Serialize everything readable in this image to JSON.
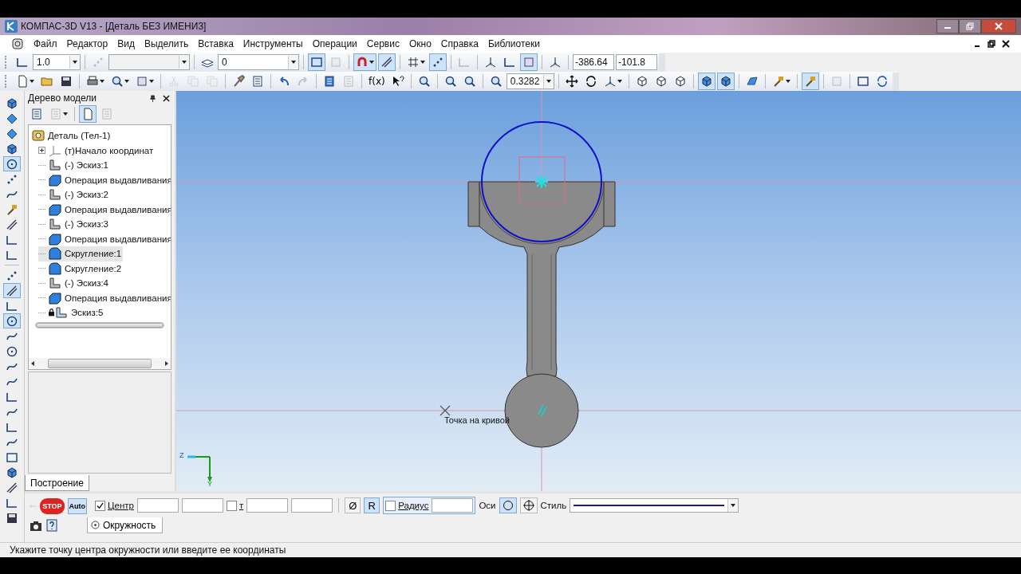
{
  "window": {
    "title": "КОМПАС-3D V13 - [Деталь БЕЗ ИМЕНИ3]"
  },
  "menu": [
    "Файл",
    "Редактор",
    "Вид",
    "Выделить",
    "Вставка",
    "Инструменты",
    "Операции",
    "Сервис",
    "Окно",
    "Справка",
    "Библиотеки"
  ],
  "toolbar_1": [
    {
      "kind": "button",
      "pressed": false,
      "disabled": false
    },
    {
      "kind": "combo",
      "value": "1.0",
      "disabled": false
    },
    {
      "kind": "button",
      "pressed": false,
      "disabled": true
    },
    {
      "kind": "combo",
      "disabled": true
    },
    {
      "kind": "button",
      "pressed": false,
      "disabled": false
    },
    {
      "kind": "combo",
      "value": "0",
      "disabled": false
    },
    {
      "kind": "button",
      "pressed": true,
      "disabled": false
    },
    {
      "kind": "button",
      "pressed": false,
      "disabled": true
    },
    {
      "kind": "button",
      "pressed": true,
      "disabled": false
    },
    {
      "kind": "button",
      "pressed": true,
      "disabled": false
    },
    {
      "kind": "button",
      "pressed": false,
      "disabled": false
    },
    {
      "kind": "button",
      "pressed": true,
      "disabled": false
    },
    {
      "kind": "button",
      "pressed": false,
      "disabled": true
    },
    {
      "kind": "button",
      "pressed": false,
      "disabled": false
    },
    {
      "kind": "button",
      "pressed": false,
      "disabled": false
    },
    {
      "kind": "button",
      "pressed": true,
      "disabled": false
    },
    {
      "kind": "button",
      "pressed": false,
      "disabled": false
    },
    {
      "kind": "field",
      "value": "-386.64"
    },
    {
      "kind": "field",
      "value": "-101.8"
    }
  ],
  "toolbar_2": [
    {
      "kind": "button",
      "pressed": false,
      "disabled": false
    },
    {
      "kind": "button",
      "pressed": false,
      "disabled": false
    },
    {
      "kind": "button",
      "pressed": false,
      "disabled": false
    },
    {
      "kind": "button",
      "pressed": false,
      "disabled": false
    },
    {
      "kind": "button",
      "pressed": false,
      "disabled": false
    },
    {
      "kind": "button",
      "pressed": false,
      "disabled": false
    },
    {
      "kind": "button",
      "pressed": false,
      "disabled": true
    },
    {
      "kind": "button",
      "pressed": false,
      "disabled": true
    },
    {
      "kind": "button",
      "pressed": false,
      "disabled": true
    },
    {
      "kind": "button",
      "pressed": false,
      "disabled": false
    },
    {
      "kind": "button",
      "pressed": false,
      "disabled": false
    },
    {
      "kind": "button",
      "pressed": false,
      "disabled": false
    },
    {
      "kind": "button",
      "pressed": false,
      "disabled": true
    },
    {
      "kind": "button",
      "pressed": false,
      "disabled": false
    },
    {
      "kind": "button",
      "pressed": false,
      "disabled": true
    },
    {
      "kind": "text_button",
      "label": "f(x)"
    },
    {
      "kind": "button",
      "pressed": false,
      "disabled": false
    },
    {
      "kind": "button",
      "pressed": false,
      "disabled": false
    },
    {
      "kind": "button",
      "pressed": false,
      "disabled": false
    },
    {
      "kind": "button",
      "pressed": false,
      "disabled": false
    },
    {
      "kind": "button",
      "pressed": false,
      "disabled": false
    },
    {
      "kind": "combo",
      "value": "0.3282",
      "disabled": false
    },
    {
      "kind": "button",
      "pressed": false,
      "disabled": false
    },
    {
      "kind": "button",
      "pressed": false,
      "disabled": false
    },
    {
      "kind": "button",
      "pressed": false,
      "disabled": false
    },
    {
      "kind": "button",
      "pressed": false,
      "disabled": false
    },
    {
      "kind": "button",
      "pressed": false,
      "disabled": false
    },
    {
      "kind": "button",
      "pressed": false,
      "disabled": false
    },
    {
      "kind": "button",
      "pressed": true,
      "disabled": false
    },
    {
      "kind": "button",
      "pressed": true,
      "disabled": false
    },
    {
      "kind": "button",
      "pressed": false,
      "disabled": false
    },
    {
      "kind": "button",
      "pressed": false,
      "disabled": false
    },
    {
      "kind": "button",
      "pressed": true,
      "disabled": false
    },
    {
      "kind": "button",
      "pressed": false,
      "disabled": true
    },
    {
      "kind": "button",
      "pressed": false,
      "disabled": false
    },
    {
      "kind": "button",
      "pressed": false,
      "disabled": false
    }
  ],
  "left_toolbar": [
    {
      "pressed": false
    },
    {
      "pressed": false
    },
    {
      "pressed": false
    },
    {
      "pressed": false
    },
    {
      "pressed": true
    },
    {
      "pressed": false
    },
    {
      "pressed": false
    },
    {
      "pressed": false
    },
    {
      "pressed": false
    },
    {
      "pressed": false
    },
    {
      "pressed": false
    },
    {
      "pressed": false
    },
    {
      "pressed": true
    },
    {
      "pressed": false
    },
    {
      "pressed": true
    },
    {
      "pressed": false
    },
    {
      "pressed": false
    },
    {
      "pressed": false
    },
    {
      "pressed": false
    },
    {
      "pressed": false
    },
    {
      "pressed": false
    },
    {
      "pressed": false
    },
    {
      "pressed": false
    },
    {
      "pressed": false
    },
    {
      "pressed": false
    },
    {
      "pressed": false
    },
    {
      "pressed": false
    },
    {
      "pressed": false
    }
  ],
  "model_tree": {
    "title": "Дерево модели",
    "root": {
      "label": "Деталь (Тел-1)",
      "kind": "part",
      "selected": false,
      "children": [
        {
          "label": "(т)Начало координат",
          "kind": "origin",
          "selected": false,
          "expanded": false
        },
        {
          "label": "(-) Эскиз:1",
          "kind": "sketch",
          "selected": false
        },
        {
          "label": "Операция выдавливания",
          "kind": "extrude",
          "selected": false
        },
        {
          "label": "(-) Эскиз:2",
          "kind": "sketch",
          "selected": false
        },
        {
          "label": "Операция выдавливания",
          "kind": "extrude",
          "selected": false
        },
        {
          "label": "(-) Эскиз:3",
          "kind": "sketch",
          "selected": false
        },
        {
          "label": "Операция выдавливания",
          "kind": "extrude",
          "selected": false
        },
        {
          "label": "Скругление:1",
          "kind": "fillet",
          "selected": true
        },
        {
          "label": "Скругление:2",
          "kind": "fillet",
          "selected": false
        },
        {
          "label": "(-) Эскиз:4",
          "kind": "sketch",
          "selected": false
        },
        {
          "label": "Операция выдавливания",
          "kind": "extrude",
          "selected": false
        },
        {
          "label": "Эскиз:5",
          "kind": "sketch_locked",
          "selected": false
        }
      ]
    }
  },
  "panel_tabs": [
    {
      "label": "Построение",
      "selected": true
    }
  ],
  "canvas": {
    "hint": "Точка на кривой",
    "axis_labels": [
      "Z",
      "Y"
    ]
  },
  "property_bar": {
    "stop_label": "STOP",
    "auto_label": "Auto",
    "center": {
      "label": "Центр",
      "checked": true
    },
    "t": {
      "label": "т",
      "checked": false
    },
    "diameter": {
      "label": "Ø",
      "pressed": false
    },
    "radius_button": {
      "label": "R",
      "pressed": true
    },
    "radius": {
      "label": "Радиус",
      "checked": false
    },
    "axes": {
      "label": "Оси",
      "options": [
        {
          "kind": "no_axes",
          "selected": true
        },
        {
          "kind": "with_axes",
          "selected": false
        }
      ]
    },
    "style": {
      "label": "Стиль"
    },
    "tabs": [
      {
        "label": "Окружность",
        "selected": true
      }
    ]
  },
  "status_bar": "Укажите точку центра окружности или введите ее координаты"
}
